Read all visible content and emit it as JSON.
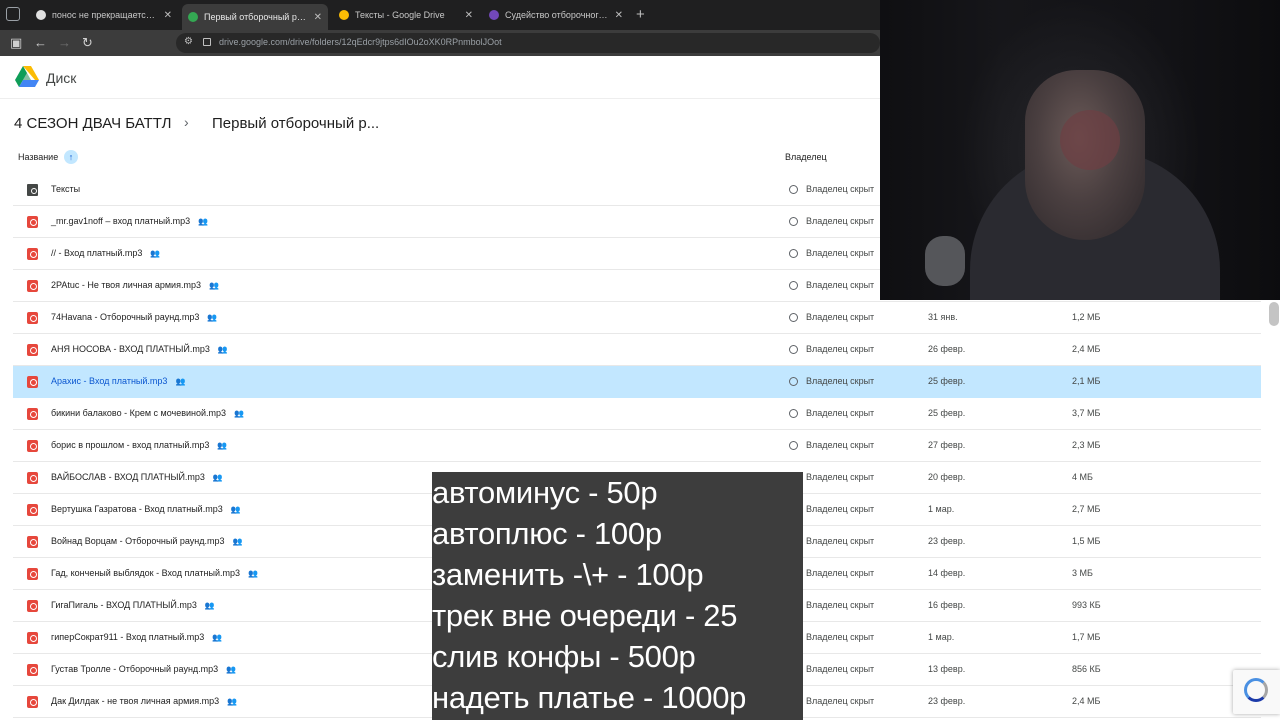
{
  "browser": {
    "tabs": [
      {
        "title": "понос не прекращается неделю",
        "favicon_color": "#e0e0e0"
      },
      {
        "title": "Первый отборочный раунд – Google Drive",
        "favicon_color": "#34a853",
        "active": true
      },
      {
        "title": "Тексты - Google Drive",
        "favicon_color": "#fbbc04"
      },
      {
        "title": "Судейство отборочного раунда",
        "favicon_color": "#7248b9"
      }
    ],
    "url": "drive.google.com/drive/folders/12qEdcr9jtps6dIOu2oXK0RPnmbolJOot"
  },
  "drive": {
    "app_name": "Диск",
    "breadcrumb": {
      "root": "4 СЕЗОН ДВАЧ БАТТЛ",
      "separator": "›",
      "current": "Первый отборочный р..."
    },
    "columns": {
      "name": "Название",
      "owner": "Владелец",
      "sort_icon": "arrow-up-icon"
    },
    "files": [
      {
        "name": "Тексты",
        "type": "folder",
        "owner": "Владелец скрыт",
        "date": "",
        "size": "",
        "shared": false
      },
      {
        "name": "_mr.gav1noff – вход платный.mp3",
        "type": "audio",
        "owner": "Владелец скрыт",
        "date": "",
        "size": "",
        "shared": true
      },
      {
        "name": "// - Вход платный.mp3",
        "type": "audio",
        "owner": "Владелец скрыт",
        "date": "",
        "size": "",
        "shared": true
      },
      {
        "name": "2PAtuc - Не твоя личная армия.mp3",
        "type": "audio",
        "owner": "Владелец скрыт",
        "date": "",
        "size": "",
        "shared": true
      },
      {
        "name": "74Havana - Отборочный раунд.mp3",
        "type": "audio",
        "owner": "Владелец скрыт",
        "date": "31 янв.",
        "size": "1,2 МБ",
        "shared": true
      },
      {
        "name": "АНЯ НОСОВА - ВХОД ПЛАТНЫЙ.mp3",
        "type": "audio",
        "owner": "Владелец скрыт",
        "date": "26 февр.",
        "size": "2,4 МБ",
        "shared": true
      },
      {
        "name": "Арахис - Вход платный.mp3",
        "type": "audio",
        "owner": "Владелец скрыт",
        "date": "25 февр.",
        "size": "2,1 МБ",
        "shared": true,
        "selected": true
      },
      {
        "name": "бикини балаково - Крем с мочевиной.mp3",
        "type": "audio",
        "owner": "Владелец скрыт",
        "date": "25 февр.",
        "size": "3,7 МБ",
        "shared": true
      },
      {
        "name": "борис в прошлом - вход платный.mp3",
        "type": "audio",
        "owner": "Владелец скрыт",
        "date": "27 февр.",
        "size": "2,3 МБ",
        "shared": true
      },
      {
        "name": "ВАЙБОСЛАВ - ВХОД ПЛАТНЫЙ.mp3",
        "type": "audio",
        "owner": "Владелец скрыт",
        "date": "20 февр.",
        "size": "4 МБ",
        "shared": true
      },
      {
        "name": "Вертушка Газратова - Вход платный.mp3",
        "type": "audio",
        "owner": "Владелец скрыт",
        "date": "1 мар.",
        "size": "2,7 МБ",
        "shared": true
      },
      {
        "name": "Войнад Ворцам - Отборочный раунд.mp3",
        "type": "audio",
        "owner": "Владелец скрыт",
        "date": "23 февр.",
        "size": "1,5 МБ",
        "shared": true
      },
      {
        "name": "Гад, конченый выблядок - Вход платный.mp3",
        "type": "audio",
        "owner": "Владелец скрыт",
        "date": "14 февр.",
        "size": "3 МБ",
        "shared": true
      },
      {
        "name": "ГигаПигаль - ВХОД ПЛАТНЫЙ.mp3",
        "type": "audio",
        "owner": "Владелец скрыт",
        "date": "16 февр.",
        "size": "993 КБ",
        "shared": true
      },
      {
        "name": "гиперСократ911 - Вход платный.mp3",
        "type": "audio",
        "owner": "Владелец скрыт",
        "date": "1 мар.",
        "size": "1,7 МБ",
        "shared": true
      },
      {
        "name": "Густав Тролле - Отборочный раунд.mp3",
        "type": "audio",
        "owner": "Владелец скрыт",
        "date": "13 февр.",
        "size": "856 КБ",
        "shared": true
      },
      {
        "name": "Дак Дилдак - не твоя личная армия.mp3",
        "type": "audio",
        "owner": "Владелец скрыт",
        "date": "23 февр.",
        "size": "2,4 МБ",
        "shared": true
      }
    ]
  },
  "overlay": {
    "prices": [
      "автоминус - 50р",
      "автоплюс - 100р",
      "заменить -\\+ - 100р",
      "трек вне очереди - 25",
      "слив конфы - 500р",
      "надеть платье - 1000р"
    ]
  }
}
